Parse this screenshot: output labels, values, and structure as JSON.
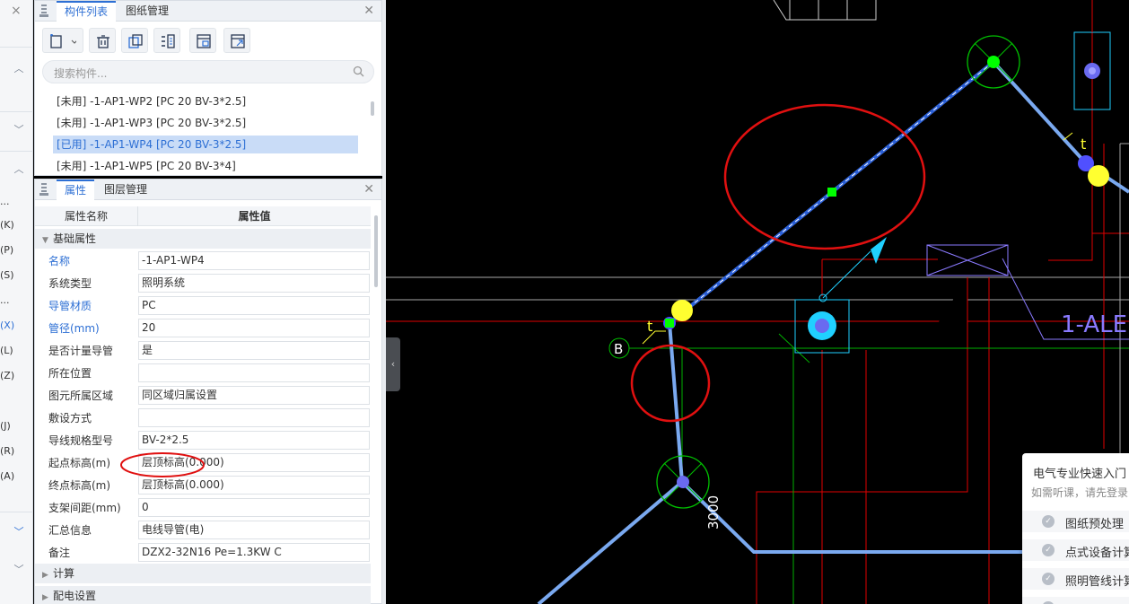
{
  "left_strip": {
    "close_glyph": "×",
    "items": [
      "(K)",
      "(P)",
      "(S)",
      "(X)",
      "(L)",
      "(Z)",
      "(J)",
      "(R)",
      "(A)"
    ],
    "ellipsis": "..."
  },
  "component_panel": {
    "tabs": [
      "构件列表",
      "图纸管理"
    ],
    "search_placeholder": "搜索构件...",
    "items": [
      "[未用] -1-AP1-WP2 [PC 20 BV-3*2.5]",
      "[未用] -1-AP1-WP3 [PC 20 BV-3*2.5]",
      "[已用] -1-AP1-WP4 [PC 20 BV-3*2.5]",
      "[未用] -1-AP1-WP5 [PC 20 BV-3*4]"
    ],
    "selected_index": 2
  },
  "property_panel": {
    "tabs": [
      "属性",
      "图层管理"
    ],
    "header": {
      "name_col": "属性名称",
      "value_col": "属性值"
    },
    "group_basic": "基础属性",
    "rows": [
      {
        "key": "名称",
        "value": "-1-AP1-WP4",
        "blue": true
      },
      {
        "key": "系统类型",
        "value": "照明系统",
        "blue": false
      },
      {
        "key": "导管材质",
        "value": "PC",
        "blue": true
      },
      {
        "key": "管径(mm)",
        "value": "20",
        "blue": true
      },
      {
        "key": "是否计量导管",
        "value": "是",
        "blue": false
      },
      {
        "key": "所在位置",
        "value": "",
        "blue": false
      },
      {
        "key": "图元所属区域",
        "value": "同区域归属设置",
        "blue": false
      },
      {
        "key": "敷设方式",
        "value": "",
        "blue": false
      },
      {
        "key": "导线规格型号",
        "value": "BV-2*2.5",
        "blue": false
      },
      {
        "key": "起点标高(m)",
        "value": "层顶标高(0.000)",
        "blue": false
      },
      {
        "key": "终点标高(m)",
        "value": "层顶标高(0.000)",
        "blue": false
      },
      {
        "key": "支架间距(mm)",
        "value": "0",
        "blue": false
      },
      {
        "key": "汇总信息",
        "value": "电线导管(电)",
        "blue": false
      },
      {
        "key": "备注",
        "value": "DZX2-32N16 Pe=1.3KW C",
        "blue": false
      }
    ],
    "group_calc": "计算",
    "group_power": "配电设置"
  },
  "cad": {
    "label_b": "B",
    "label_t1": "t",
    "label_t2": "t",
    "dim_3000": "3000",
    "label_ale": "1-ALE",
    "colors": {
      "wire": "#7aa9f0",
      "red": "#ff1010",
      "green": "#00ff00",
      "yellow": "#ffff30",
      "cyan": "#20d0ff"
    }
  },
  "popup": {
    "title": "电气专业快速入门",
    "subtitle": "如需听课，请先登录",
    "items": [
      "图纸预处理",
      "点式设备计算",
      "照明管线计算",
      "..."
    ]
  }
}
